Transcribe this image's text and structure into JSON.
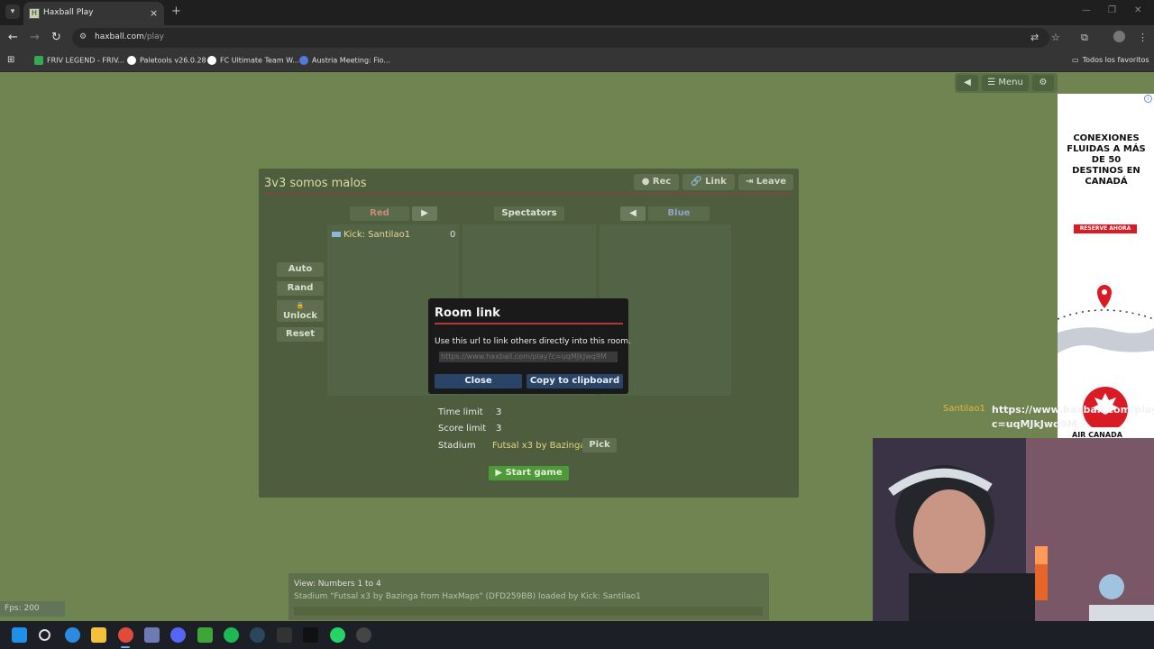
{
  "browser": {
    "tab_title": "Haxball Play",
    "tab_close": "×",
    "new_tab": "+",
    "url_host": "haxball.com",
    "url_path": "/play",
    "bookmarks": [
      {
        "label": "FRIV LEGEND - FRIV...",
        "color": "#34a853"
      },
      {
        "label": "Paletools v26.0.28",
        "color": "#ffffff"
      },
      {
        "label": "FC Ultimate Team W...",
        "color": "#ffffff"
      },
      {
        "label": "Austria Meeting: Fio...",
        "color": "#4f7bd9"
      }
    ],
    "all_bookmarks": "Todos los favoritos"
  },
  "game": {
    "top_menu": {
      "sound": "◀",
      "menu_label": "☰ Menu",
      "settings": "⚙"
    },
    "room": {
      "title": "3v3 somos malos",
      "rec": "● Rec",
      "link": "🔗 Link",
      "leave": "⇥ Leave",
      "red_label": "Red",
      "spectators_label": "Spectators",
      "blue_label": "Blue",
      "move_right": "▶",
      "move_left": "◀",
      "red_players": [
        {
          "name": "Kick: Santilao1",
          "score": "0"
        }
      ],
      "auto": "Auto",
      "rand": "Rand",
      "unlock_icon": "🔒",
      "unlock": "Unlock",
      "reset": "Reset",
      "time_limit_label": "Time limit",
      "time_limit": "3",
      "score_limit_label": "Score limit",
      "score_limit": "3",
      "stadium_label": "Stadium",
      "stadium": "Futsal x3 by Bazinga ...",
      "pick": "Pick",
      "start": "▶ Start game"
    },
    "dialog": {
      "title": "Room link",
      "text": "Use this url to link others directly into this room.",
      "url": "https://www.haxball.com/play?c=uqMJkJwq9M",
      "close": "Close",
      "copy": "Copy to clipboard"
    },
    "chat": {
      "lines": [
        "View: Numbers 1 to 4",
        "Stadium \"Futsal x3 by Bazinga from HaxMaps\" (DFD259BB) loaded by Kick: Santilao1"
      ]
    },
    "fps": "Fps: 200"
  },
  "ad": {
    "headline": "CONEXIONES FLUIDAS A MÁS DE 50 DESTINOS EN CANADÁ",
    "cta": "RESERVE AHORA",
    "brand": "AIR CANADA"
  },
  "overlay": {
    "name": "Santilao1",
    "message": "https://www.haxball.com/play?c=uqMJkJwq9M"
  }
}
